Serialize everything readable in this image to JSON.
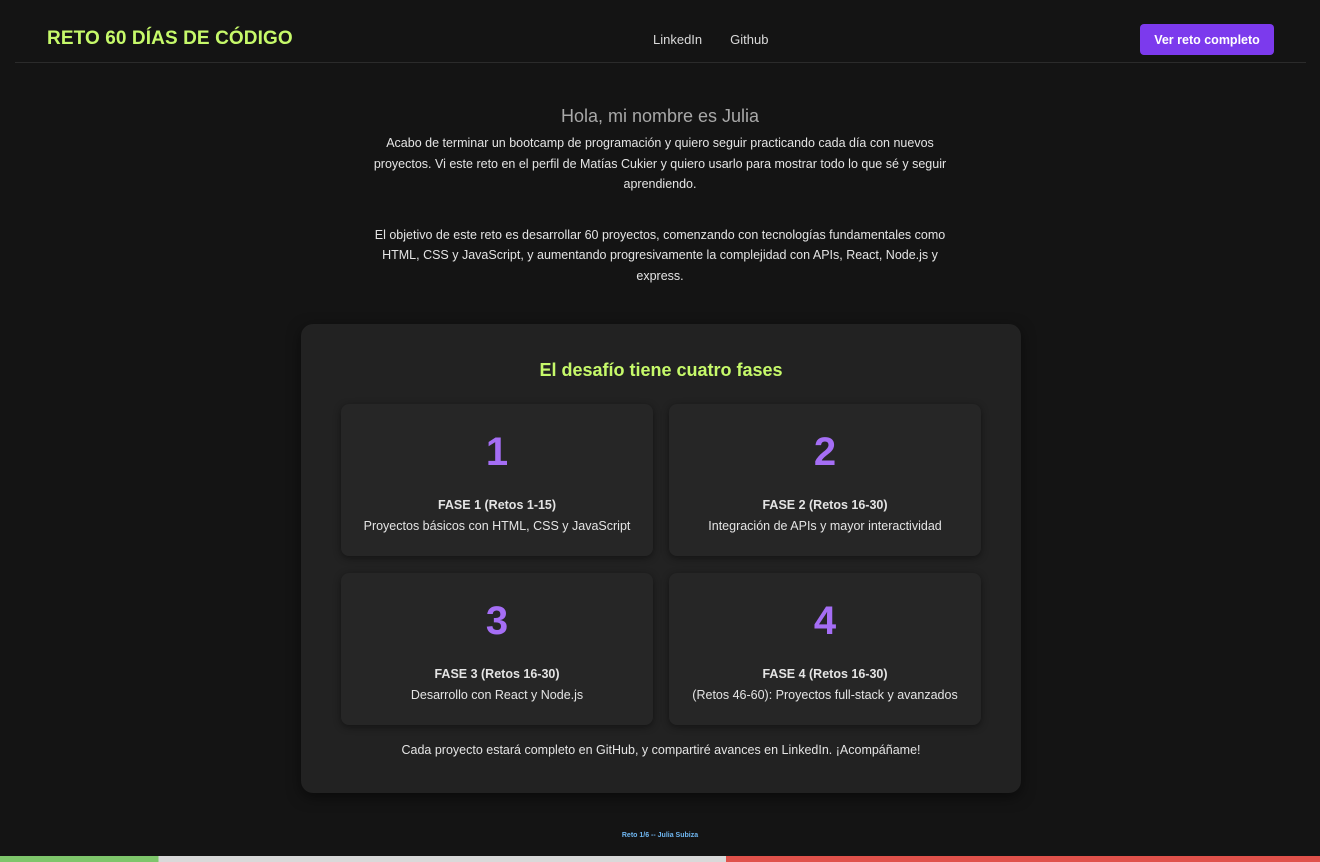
{
  "header": {
    "brand": "RETO 60 DÍAS DE CÓDIGO",
    "nav": [
      "LinkedIn",
      "Github"
    ],
    "cta_label": "Ver reto completo"
  },
  "intro": {
    "greeting": "Hola, mi nombre es Julia",
    "paragraph1": "Acabo de terminar un bootcamp de programación y quiero seguir practicando cada día con nuevos proyectos. Vi este reto en el perfil de Matías Cukier y quiero usarlo para mostrar todo lo que sé y seguir aprendiendo.",
    "paragraph2": "El objetivo de este reto es desarrollar 60 proyectos, comenzando con tecnologías fundamentales como HTML, CSS y JavaScript, y aumentando progresivamente la complejidad con APIs, React, Node.js y express."
  },
  "phases": {
    "heading": "El desafío tiene cuatro fases",
    "cards": [
      {
        "number": "1",
        "title": "FASE 1 (Retos 1-15)",
        "description": "Proyectos básicos con HTML, CSS y JavaScript"
      },
      {
        "number": "2",
        "title": "FASE 2 (Retos 16-30)",
        "description": "Integración de APIs y mayor interactividad"
      },
      {
        "number": "3",
        "title": "FASE 3 (Retos 16-30)",
        "description": "Desarrollo con React y Node.js"
      },
      {
        "number": "4",
        "title": "FASE 4 (Retos 16-30)",
        "description": "(Retos 46-60): Proyectos full-stack y avanzados"
      }
    ],
    "footer_note": "Cada proyecto estará completo en GitHub, y compartiré avances en LinkedIn. ¡Acompáñame!"
  },
  "credit": "Reto 1/6 -- Julia Subiza",
  "colors": {
    "accent_green": "#c6f96a",
    "accent_purple": "#7c3aed",
    "number_purple": "#a56ef5",
    "background": "#141414"
  }
}
